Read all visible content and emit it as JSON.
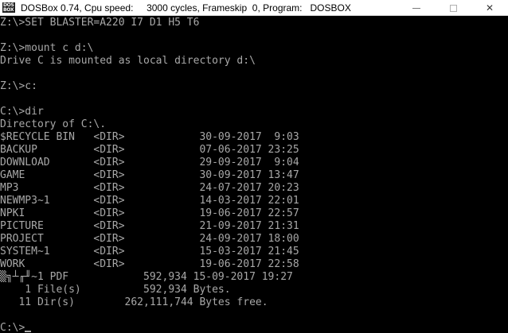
{
  "window": {
    "app_icon_text": "DOS BOX",
    "title": "DOSBox 0.74, Cpu speed:     3000 cycles, Frameskip  0, Program:   DOSBOX",
    "controls": {
      "minimize": "minimize",
      "maximize": "maximize",
      "close": "✕"
    }
  },
  "console": {
    "lines": [
      "Z:\\>SET BLASTER=A220 I7 D1 H5 T6",
      "",
      "Z:\\>mount c d:\\",
      "Drive C is mounted as local directory d:\\",
      "",
      "Z:\\>c:",
      "",
      "C:\\>dir",
      "Directory of C:\\.",
      "$RECYCLE BIN   <DIR>            30-09-2017  9:03",
      "BACKUP         <DIR>            07-06-2017 23:25",
      "DOWNLOAD       <DIR>            29-09-2017  9:04",
      "GAME           <DIR>            30-09-2017 13:47",
      "MP3            <DIR>            24-07-2017 20:23",
      "NEWMP3~1       <DIR>            14-03-2017 22:01",
      "NPKI           <DIR>            19-06-2017 22:57",
      "PICTURE        <DIR>            21-09-2017 21:31",
      "PROJECT        <DIR>            24-09-2017 18:00",
      "SYSTEM~1       <DIR>            15-03-2017 21:45",
      "WORK           <DIR>            19-06-2017 22:58",
      "▒╗┴╓╜~1 PDF            592,934 15-09-2017 19:27",
      "    1 File(s)          592,934 Bytes.",
      "   11 Dir(s)        262,111,744 Bytes free.",
      "",
      "C:\\>"
    ]
  },
  "colors": {
    "console_bg": "#000000",
    "console_fg": "#a8a8a8",
    "titlebar_bg": "#ffffff"
  }
}
